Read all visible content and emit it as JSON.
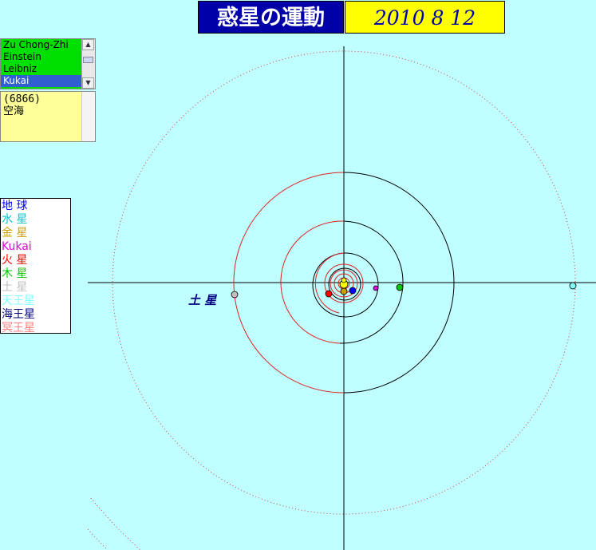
{
  "header": {
    "title": "惑星の運動",
    "date": "2010 8 12"
  },
  "asteroid_list": {
    "items": [
      "Zu Chong-Zhi",
      "Einstein",
      "Leibniz",
      "Kukai"
    ],
    "selected_index": 3
  },
  "info_panel": {
    "number": "(6866)",
    "name_jp": "空海"
  },
  "legend": {
    "items": [
      {
        "label": "地  球",
        "color": "#0000ff"
      },
      {
        "label": "水  星",
        "color": "#00c8c8"
      },
      {
        "label": "金  星",
        "color": "#c8a000"
      },
      {
        "label": "Kukai",
        "color": "#e000e0"
      },
      {
        "label": "火  星",
        "color": "#ff0000"
      },
      {
        "label": "木  星",
        "color": "#00c800"
      },
      {
        "label": "土  星",
        "color": "#c0c0c0"
      },
      {
        "label": "天王星",
        "color": "#80ffff"
      },
      {
        "label": "海王星",
        "color": "#000080"
      },
      {
        "label": "冥王星",
        "color": "#ff8080"
      }
    ]
  },
  "map_labels": {
    "saturn": "土  星"
  },
  "colors": {
    "background": "#c0ffff",
    "title_bg": "#0000a8",
    "date_bg": "#ffff00",
    "list_bg": "#00e000",
    "list_selected": "#2f5fd0",
    "info_bg": "#ffff99",
    "sun": "#ffff00",
    "earth": "#0000ff",
    "mars": "#ff0000",
    "venus": "#c8a000",
    "kukai": "#e000e0",
    "jupiter": "#00c800",
    "saturn": "#c0c0c0",
    "uranus": "#80ffff"
  }
}
